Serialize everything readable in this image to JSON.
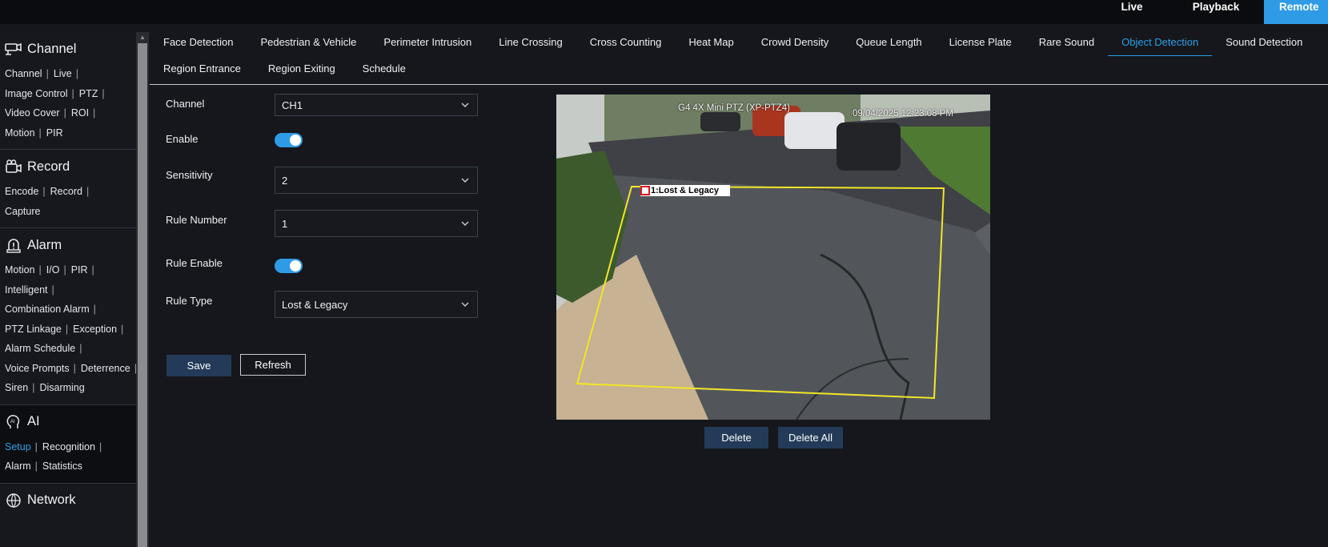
{
  "topnav": {
    "live": "Live",
    "playback": "Playback",
    "remote": "Remote"
  },
  "sidebar": {
    "channel": {
      "title": "Channel",
      "rows": [
        [
          "Channel",
          "Live"
        ],
        [
          "Image Control",
          "PTZ"
        ],
        [
          "Video Cover",
          "ROI"
        ],
        [
          "Motion",
          "PIR"
        ]
      ]
    },
    "record": {
      "title": "Record",
      "rows": [
        [
          "Encode",
          "Record"
        ],
        [
          "Capture"
        ]
      ]
    },
    "alarm": {
      "title": "Alarm",
      "rows": [
        [
          "Motion",
          "I/O",
          "PIR"
        ],
        [
          "Intelligent"
        ],
        [
          "Combination Alarm"
        ],
        [
          "PTZ Linkage",
          "Exception"
        ],
        [
          "Alarm Schedule"
        ],
        [
          "Voice Prompts",
          "Deterrence"
        ],
        [
          "Siren",
          "Disarming"
        ]
      ]
    },
    "ai": {
      "title": "AI",
      "rows": [
        [
          "Setup",
          "Recognition"
        ],
        [
          "Alarm",
          "Statistics"
        ]
      ],
      "active_item": "Setup"
    },
    "network": {
      "title": "Network"
    }
  },
  "tabs": {
    "row1": [
      "Face Detection",
      "Pedestrian & Vehicle",
      "Perimeter Intrusion",
      "Line Crossing",
      "Cross Counting",
      "Heat Map",
      "Crowd Density",
      "Queue Length",
      "License Plate",
      "Rare Sound",
      "Object Detection",
      "Sound Detection"
    ],
    "row2": [
      "Region Entrance",
      "Region Exiting",
      "Schedule"
    ],
    "active": "Object Detection"
  },
  "form": {
    "channel_label": "Channel",
    "channel_value": "CH1",
    "enable_label": "Enable",
    "enable_on": true,
    "sensitivity_label": "Sensitivity",
    "sensitivity_value": "2",
    "rule_number_label": "Rule Number",
    "rule_number_value": "1",
    "rule_enable_label": "Rule Enable",
    "rule_enable_on": true,
    "rule_type_label": "Rule Type",
    "rule_type_value": "Lost & Legacy",
    "save": "Save",
    "refresh": "Refresh"
  },
  "video": {
    "camera_name": "G4 4X Mini PTZ (XP-PTZ4)",
    "timestamp": "09/04/2025 12:23:08 PM",
    "rule_label": "1:Lost & Legacy",
    "delete": "Delete",
    "delete_all": "Delete All"
  },
  "colors": {
    "accent": "#2d9ee8",
    "button": "#233b58",
    "rule_line": "#f2e627"
  }
}
